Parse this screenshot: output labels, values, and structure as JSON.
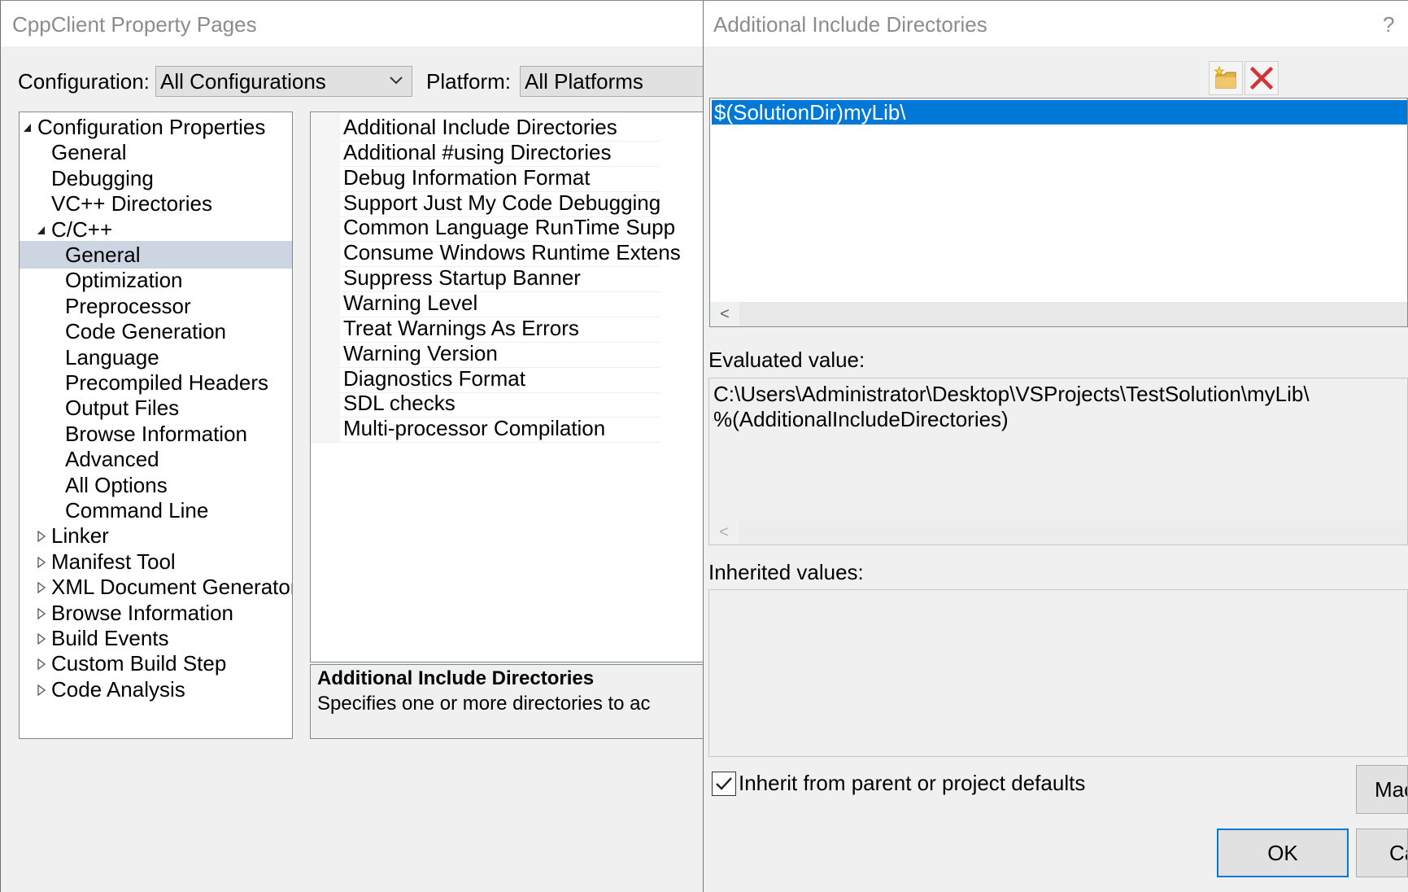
{
  "property_pages": {
    "title": "CppClient Property Pages",
    "configuration_label": "Configuration:",
    "configuration_value": "All Configurations",
    "platform_label": "Platform:",
    "platform_value": "All Platforms",
    "tree": [
      {
        "label": "Configuration Properties",
        "state": "expanded"
      },
      {
        "label": "General"
      },
      {
        "label": "Debugging"
      },
      {
        "label": "VC++ Directories"
      },
      {
        "label": "C/C++",
        "state": "expanded"
      },
      {
        "label": "General",
        "selected": true
      },
      {
        "label": "Optimization"
      },
      {
        "label": "Preprocessor"
      },
      {
        "label": "Code Generation"
      },
      {
        "label": "Language"
      },
      {
        "label": "Precompiled Headers"
      },
      {
        "label": "Output Files"
      },
      {
        "label": "Browse Information"
      },
      {
        "label": "Advanced"
      },
      {
        "label": "All Options"
      },
      {
        "label": "Command Line"
      },
      {
        "label": "Linker",
        "state": "collapsed"
      },
      {
        "label": "Manifest Tool",
        "state": "collapsed"
      },
      {
        "label": "XML Document Generator",
        "state": "collapsed"
      },
      {
        "label": "Browse Information",
        "state": "collapsed"
      },
      {
        "label": "Build Events",
        "state": "collapsed"
      },
      {
        "label": "Custom Build Step",
        "state": "collapsed"
      },
      {
        "label": "Code Analysis",
        "state": "collapsed"
      }
    ],
    "properties": [
      "Additional Include Directories",
      "Additional #using Directories",
      "Debug Information Format",
      "Support Just My Code Debugging",
      "Common Language RunTime Supp",
      "Consume Windows Runtime Extens",
      "Suppress Startup Banner",
      "Warning Level",
      "Treat Warnings As Errors",
      "Warning Version",
      "Diagnostics Format",
      "SDL checks",
      "Multi-processor Compilation"
    ],
    "description_title": "Additional Include Directories",
    "description_text": "Specifies one or more directories to ac"
  },
  "include_dialog": {
    "title": "Additional Include Directories",
    "help_glyph": "?",
    "entries": [
      "$(SolutionDir)myLib\\"
    ],
    "scroll_left_glyph": "<",
    "evaluated_label": "Evaluated value:",
    "evaluated_lines": [
      "C:\\Users\\Administrator\\Desktop\\VSProjects\\TestSolution\\myLib\\",
      "%(AdditionalIncludeDirectories)"
    ],
    "inherited_label": "Inherited values:",
    "inherit_checkbox_label": "Inherit from parent or project defaults",
    "inherit_checked": true,
    "macros_button_label": "Mac",
    "ok_button_label": "OK",
    "cancel_button_label": "Ca",
    "new_line_icon": "new-folder-icon",
    "delete_icon": "delete-x-icon",
    "colors": {
      "selection": "#0078d7",
      "delete": "#d13438",
      "folder": "#e8b04a"
    }
  }
}
